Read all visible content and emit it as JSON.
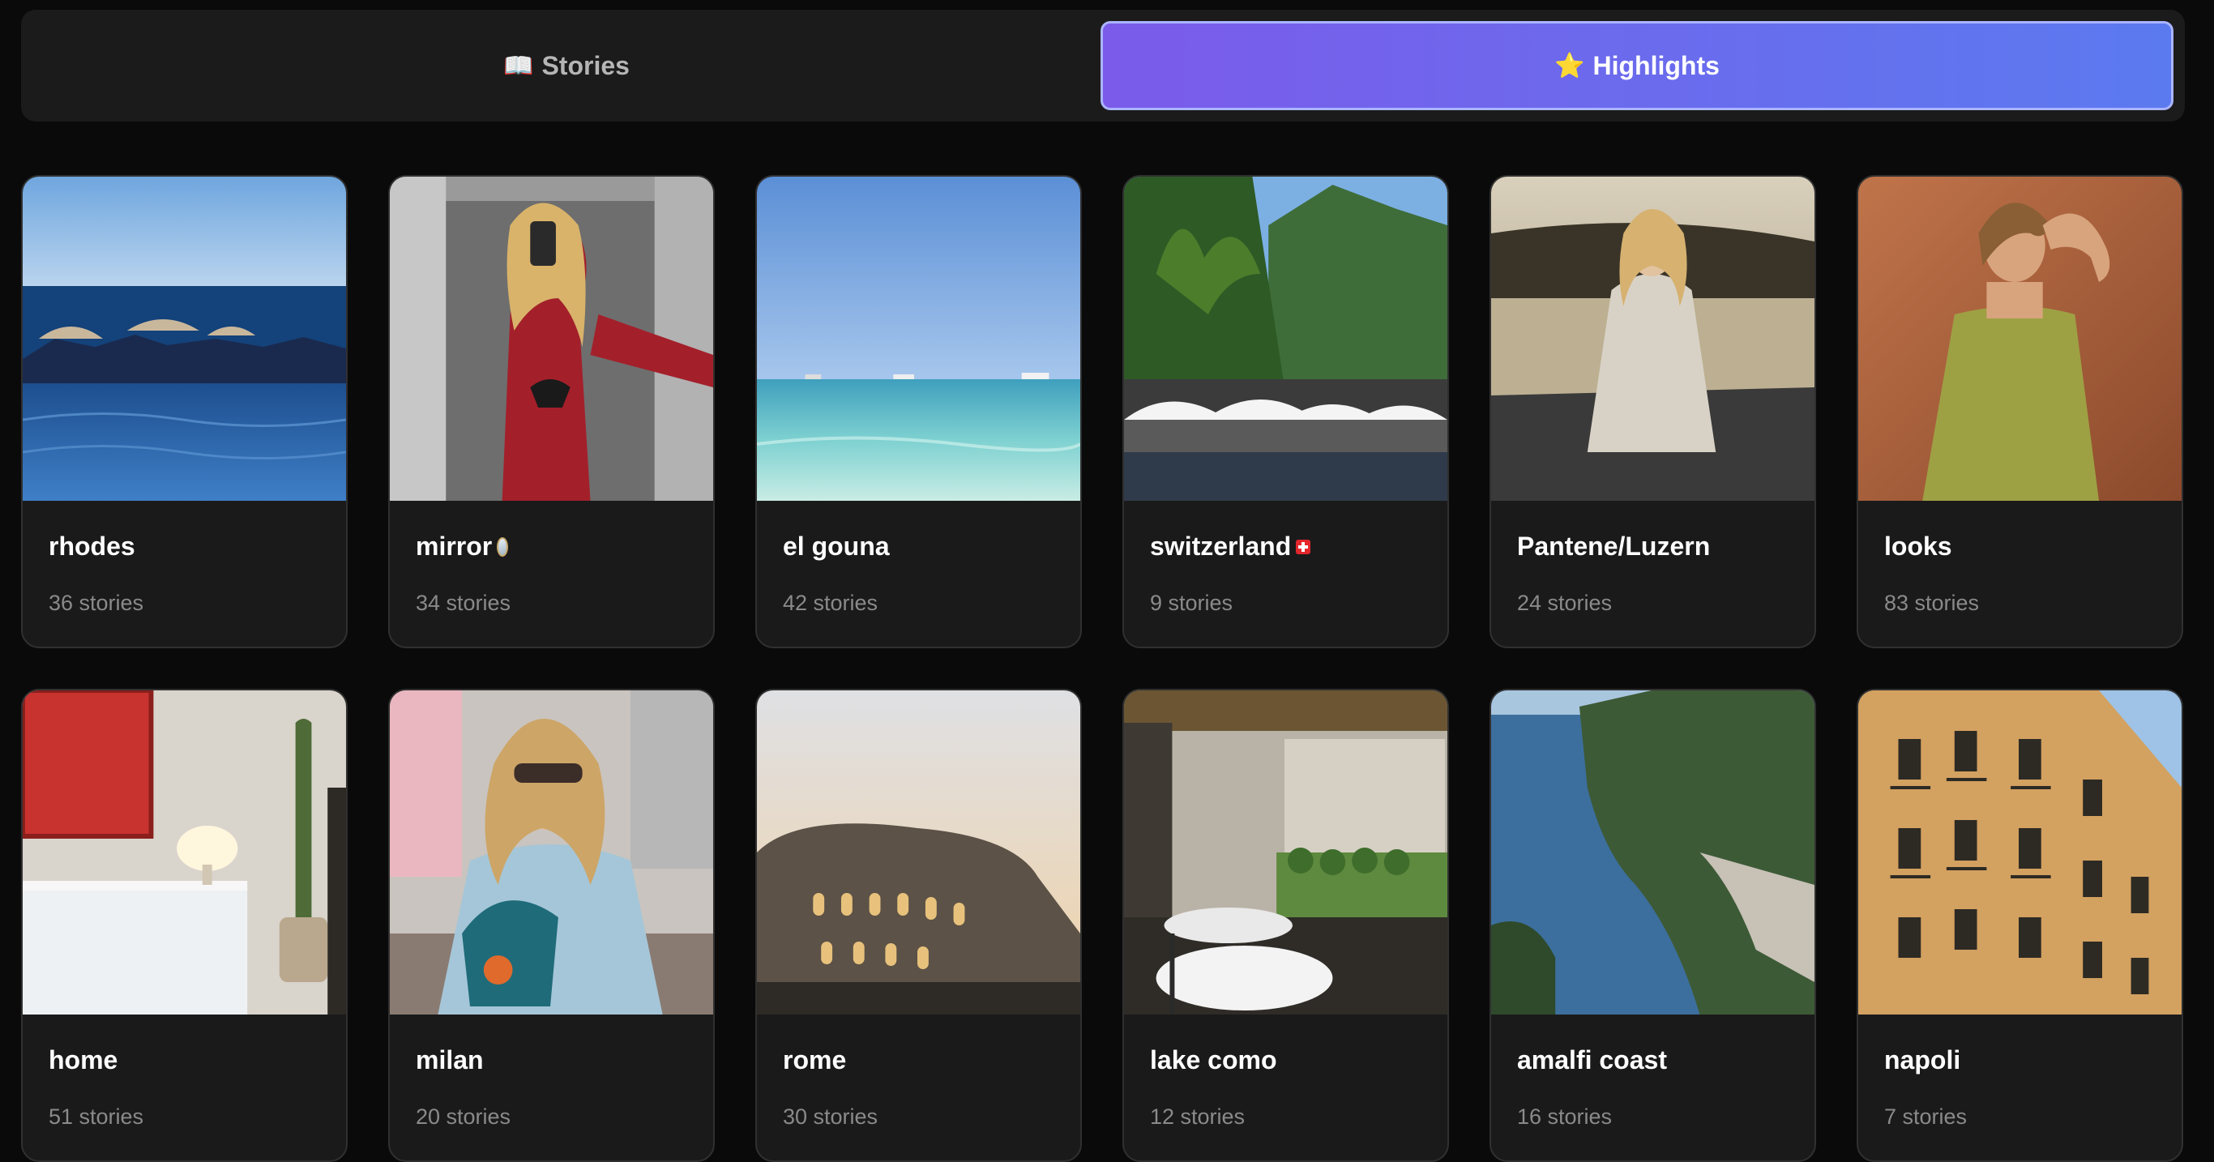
{
  "tabs": [
    {
      "label": "Stories",
      "icon": "📖",
      "active": false
    },
    {
      "label": "Highlights",
      "icon": "⭐",
      "active": true
    }
  ],
  "highlights": [
    {
      "title": "rhodes",
      "count": "36 stories",
      "thumb": "sea-pool"
    },
    {
      "title": "mirror",
      "count": "34 stories",
      "thumb": "mirror-selfie",
      "emoji": "mirror"
    },
    {
      "title": "el gouna",
      "count": "42 stories",
      "thumb": "turquoise-sea"
    },
    {
      "title": "switzerland",
      "count": "9 stories",
      "thumb": "lakeside-terrace",
      "emoji": "swiss-flag"
    },
    {
      "title": "Pantene/Luzern",
      "count": "24 stories",
      "thumb": "lake-portrait"
    },
    {
      "title": "looks",
      "count": "83 stories",
      "thumb": "green-dress"
    },
    {
      "title": "home",
      "count": "51 stories",
      "thumb": "interior"
    },
    {
      "title": "milan",
      "count": "20 stories",
      "thumb": "street-portrait"
    },
    {
      "title": "rome",
      "count": "30 stories",
      "thumb": "colosseum"
    },
    {
      "title": "lake como",
      "count": "12 stories",
      "thumb": "villa-terrace"
    },
    {
      "title": "amalfi coast",
      "count": "16 stories",
      "thumb": "coastline"
    },
    {
      "title": "napoli",
      "count": "7 stories",
      "thumb": "palazzo"
    }
  ],
  "colors": {
    "background": "#0a0a0a",
    "card": "#1a1a1a",
    "accent_start": "#7b5bea",
    "accent_end": "#5b7af0",
    "muted_text": "#8a8a8a"
  }
}
